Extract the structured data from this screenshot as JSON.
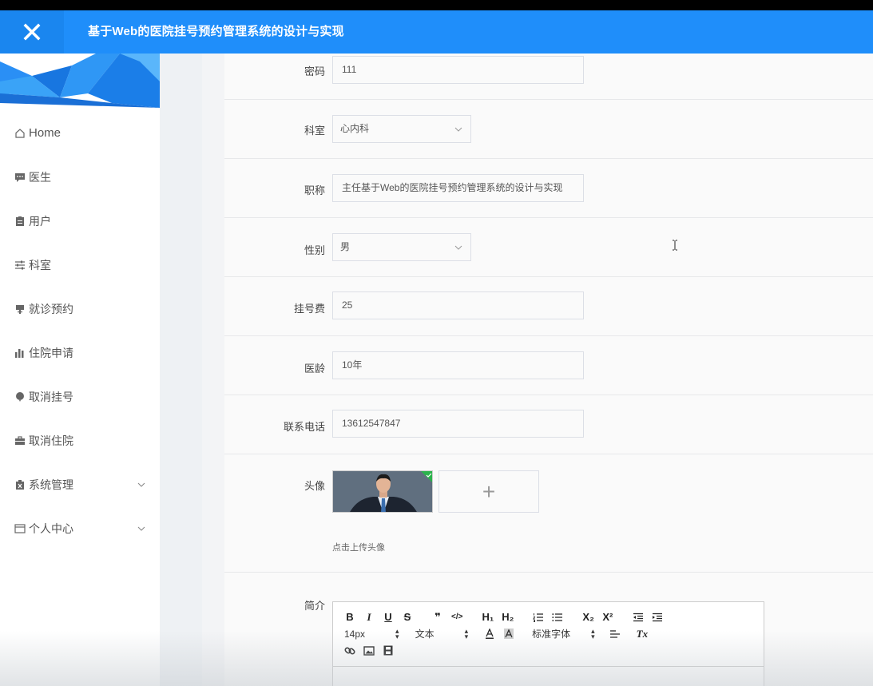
{
  "header": {
    "title": "基于Web的医院挂号预约管理系统的设计与实现",
    "close_icon": "close-icon",
    "bg_color": "#1f8efa"
  },
  "sidebar": {
    "items": [
      {
        "label": "Home",
        "icon": "home-icon"
      },
      {
        "label": "医生",
        "icon": "chat-icon"
      },
      {
        "label": "用户",
        "icon": "clipboard-icon"
      },
      {
        "label": "科室",
        "icon": "sliders-icon"
      },
      {
        "label": "就诊预约",
        "icon": "sign-icon"
      },
      {
        "label": "住院申请",
        "icon": "bar-chart-icon"
      },
      {
        "label": "取消挂号",
        "icon": "balloon-icon"
      },
      {
        "label": "取消住院",
        "icon": "briefcase-icon"
      },
      {
        "label": "系统管理",
        "icon": "trash-icon",
        "expandable": true
      },
      {
        "label": "个人中心",
        "icon": "window-icon",
        "expandable": true
      }
    ]
  },
  "form": {
    "password": {
      "label": "密码",
      "value": "111"
    },
    "department": {
      "label": "科室",
      "value": "心内科"
    },
    "title": {
      "label": "职称",
      "value": "主任基于Web的医院挂号预约管理系统的设计与实现"
    },
    "gender": {
      "label": "性别",
      "value": "男"
    },
    "fee": {
      "label": "挂号费",
      "value": "25"
    },
    "seniority": {
      "label": "医龄",
      "value": "10年"
    },
    "phone": {
      "label": "联系电话",
      "value": "13612547847"
    },
    "avatar": {
      "label": "头像",
      "hint": "点击上传头像",
      "add_symbol": "+"
    },
    "intro": {
      "label": "简介"
    }
  },
  "editor": {
    "row1": [
      "B",
      "I",
      "U",
      "S",
      "❞",
      "</>",
      "H₁",
      "H₂",
      "ordered-list",
      "bullet-list",
      "X₂",
      "X²",
      "outdent",
      "indent"
    ],
    "font_size": "14px",
    "format": "文本",
    "font_family": "标准字体",
    "clear_format": "Tx",
    "row3": [
      "link-icon",
      "image-icon",
      "video-icon"
    ]
  }
}
